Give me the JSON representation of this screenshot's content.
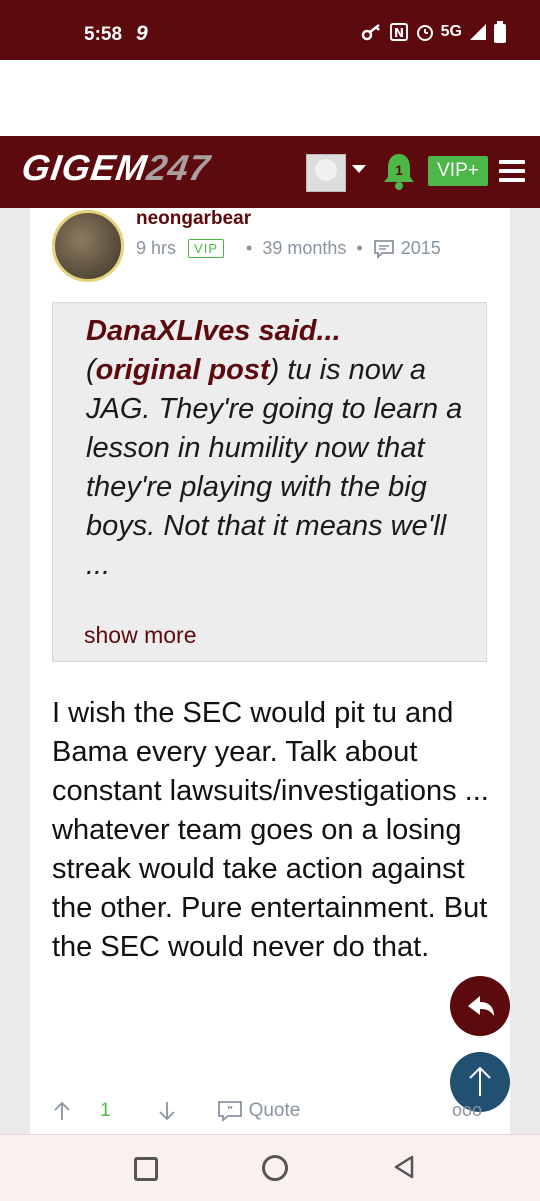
{
  "status_bar": {
    "time": "5:58",
    "notification_glyph": "9",
    "network": "5G",
    "icons": [
      "key-icon",
      "nfc-icon",
      "alarm-icon",
      "signal-icon",
      "battery-icon"
    ]
  },
  "header": {
    "logo_text": "GIGEM",
    "logo_number": "247",
    "notification_count": "1",
    "vip_label": "VIP+",
    "colors": {
      "primary": "#5c0a0d",
      "green": "#4db848"
    }
  },
  "post": {
    "username": "neongarbear",
    "time_ago": "9 hrs",
    "badge": "VIP",
    "tenure": "39 months",
    "post_count": "2015",
    "quote": {
      "author": "DanaXLIves said...",
      "link_open": "(",
      "link_text": "original post",
      "link_close": ")",
      "text": " tu is now a JAG. They're going to learn a lesson in humility now that they're playing with the big boys. Not that it means we'll ...",
      "show_more": "show more"
    },
    "body": "I wish the SEC would pit tu and Bama every year. Talk about constant lawsuits/investigations ... whatever team goes on a losing streak would take action against the other. Pure entertainment. But the SEC would never do that.",
    "actions": {
      "vote_count": "1",
      "quote_label": "Quote",
      "more": "ooo"
    }
  }
}
